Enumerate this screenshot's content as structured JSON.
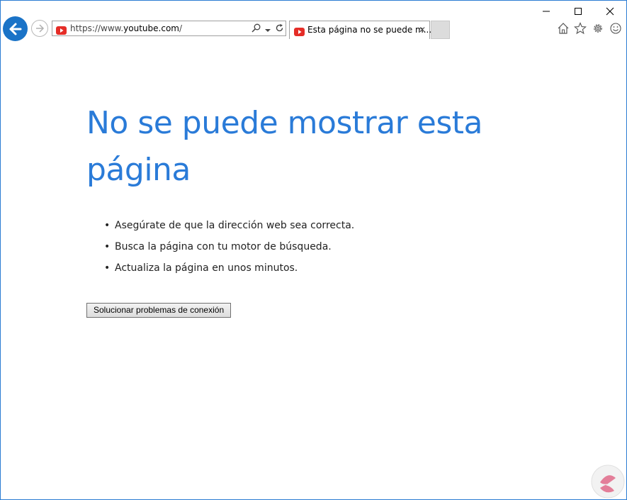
{
  "address_bar": {
    "url_prefix": "https://www.",
    "url_host": "youtube.com",
    "url_suffix": "/"
  },
  "tab": {
    "title": "Esta página no se puede m...",
    "close_glyph": "✕"
  },
  "content": {
    "title": "No se puede mostrar esta página",
    "tips": [
      "Asegúrate de que la dirección web sea correcta.",
      "Busca la página con tu motor de búsqueda.",
      "Actualiza la página en unos minutos."
    ],
    "bullet": "•",
    "diagnose_button": "Solucionar problemas de conexión"
  },
  "colors": {
    "accent": "#2a7bd8",
    "back_button": "#1a73c7",
    "youtube_red": "#e52d27",
    "watermark": "#e06a8a"
  },
  "icons": [
    "back-arrow-icon",
    "forward-arrow-icon",
    "youtube-icon",
    "search-icon",
    "dropdown-icon",
    "refresh-icon",
    "home-icon",
    "favorites-star-icon",
    "settings-gear-icon",
    "feedback-smiley-icon",
    "minimize-icon",
    "maximize-icon",
    "close-icon"
  ]
}
